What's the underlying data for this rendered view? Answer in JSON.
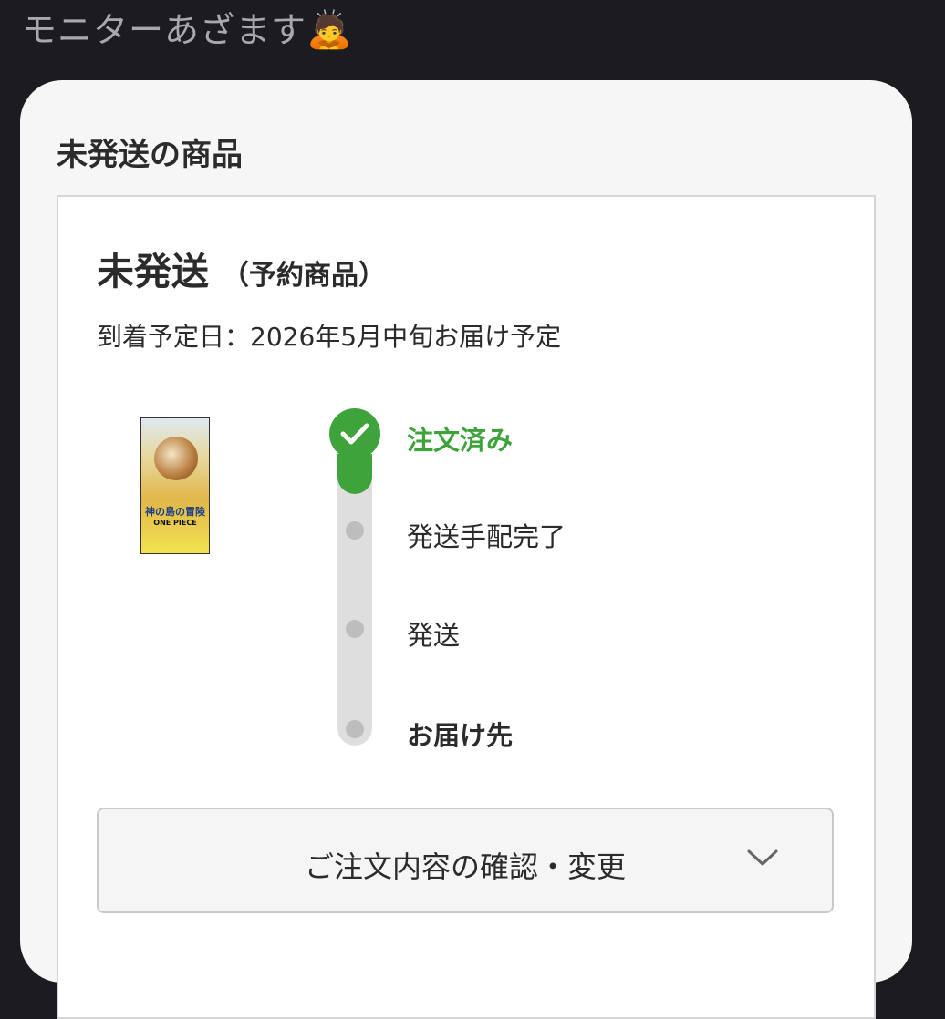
{
  "caption": {
    "text": "モニターあざます",
    "emoji": "🙇"
  },
  "section": {
    "title": "未発送の商品"
  },
  "order": {
    "status": "未発送",
    "status_note": "（予約商品）",
    "arrival": "到着予定日：2026年5月中旬お届け予定",
    "product": {
      "title": "神の島の冒険",
      "logo": "ONE PIECE"
    },
    "progress": {
      "completed_steps": 1,
      "steps": [
        {
          "label": "注文済み",
          "state": "done"
        },
        {
          "label": "発送手配完了",
          "state": "pending"
        },
        {
          "label": "発送",
          "state": "pending"
        },
        {
          "label": "お届け先",
          "state": "pending"
        }
      ]
    },
    "confirm_button": {
      "label": "ご注文内容の確認・変更",
      "icon": "chevron-down-icon"
    }
  },
  "colors": {
    "accent": "#3ea33a",
    "page_bg": "#1c1c20",
    "card_bg": "#f6f6f6"
  }
}
